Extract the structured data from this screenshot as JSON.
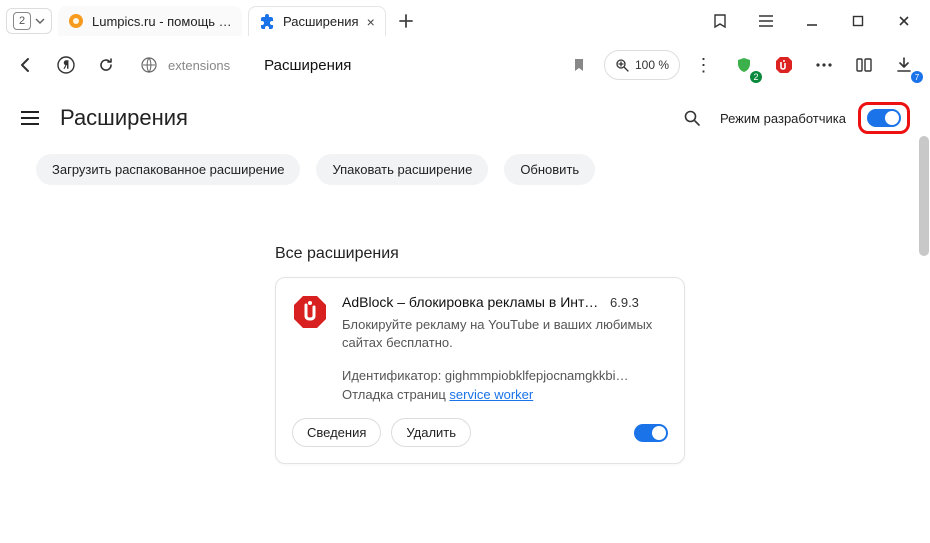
{
  "tabs": {
    "count": "2",
    "inactive_label": "Lumpics.ru - помощь с ком",
    "active_label": "Расширения"
  },
  "addr": {
    "host": "extensions",
    "title": "Расширения"
  },
  "zoom": {
    "label": "100 %"
  },
  "shield_badge": "2",
  "download_badge": "7",
  "page": {
    "title": "Расширения",
    "dev_label": "Режим разработчика"
  },
  "dev_buttons": {
    "load_unpacked": "Загрузить распакованное расширение",
    "pack": "Упаковать расширение",
    "update": "Обновить"
  },
  "section_title": "Все расширения",
  "ext": {
    "title": "AdBlock – блокировка рекламы в Интер…",
    "version": "6.9.3",
    "desc": "Блокируйте рекламу на YouTube и ваших любимых сайтах бесплатно.",
    "id_label": "Идентификатор: gighmmpiobklfepjocnamgkkbi…",
    "debug_label": "Отладка страниц",
    "debug_link": "service worker",
    "details": "Сведения",
    "remove": "Удалить"
  }
}
